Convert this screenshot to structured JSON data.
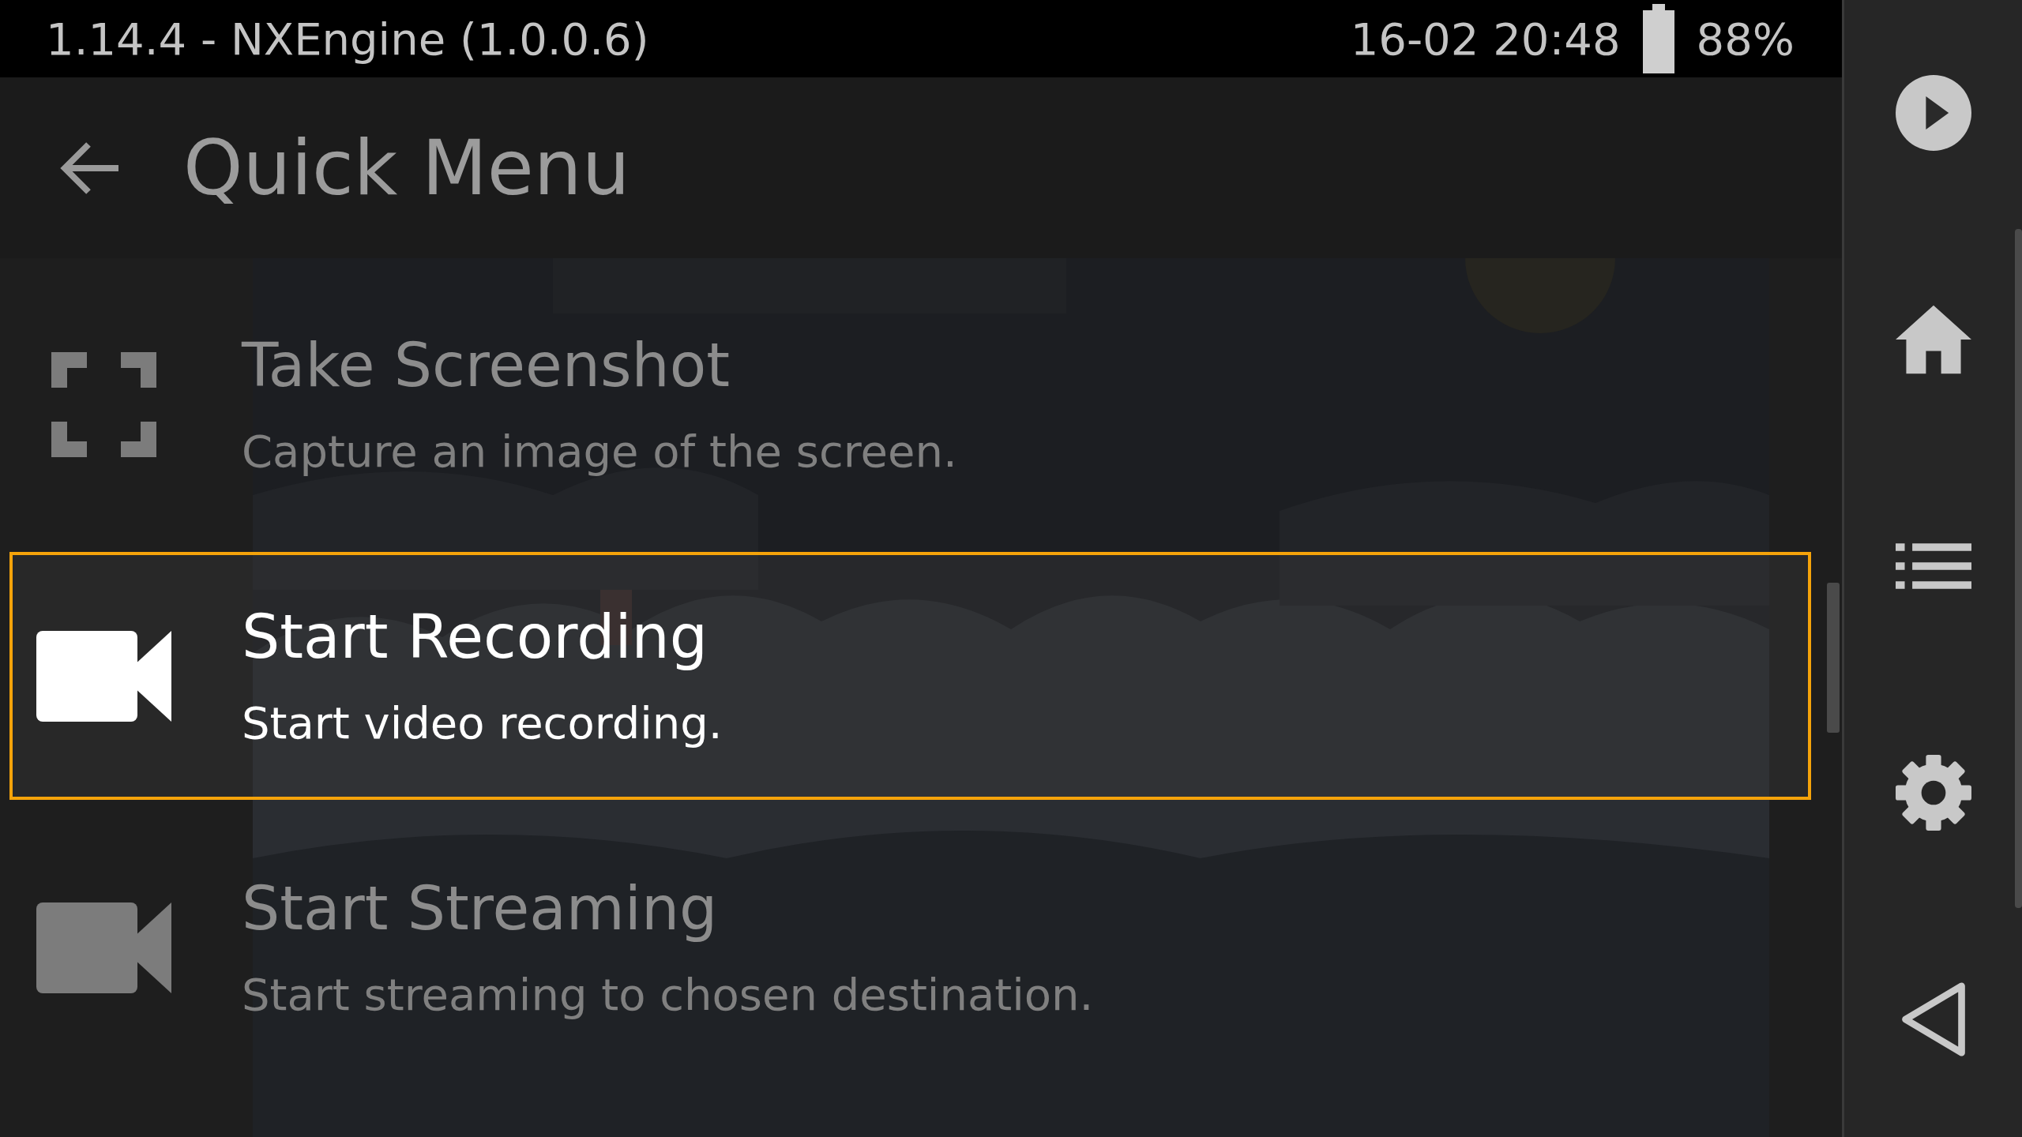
{
  "status_bar": {
    "title": "1.14.4 - NXEngine (1.0.0.6)",
    "clock": "16-02 20:48",
    "battery": "88%"
  },
  "header": {
    "title": "Quick Menu"
  },
  "menu": {
    "items": [
      {
        "kind": "screenshot",
        "title": "Take Screenshot",
        "subtitle": "Capture an image of the screen.",
        "selected": false
      },
      {
        "kind": "camera",
        "title": "Start Recording",
        "subtitle": "Start video recording.",
        "selected": true
      },
      {
        "kind": "camera",
        "title": "Start Streaming",
        "subtitle": "Start streaming to chosen destination.",
        "selected": false
      }
    ]
  },
  "sidebar": {
    "items": [
      {
        "kind": "play"
      },
      {
        "kind": "home"
      },
      {
        "kind": "list"
      },
      {
        "kind": "settings"
      },
      {
        "kind": "back"
      }
    ]
  }
}
